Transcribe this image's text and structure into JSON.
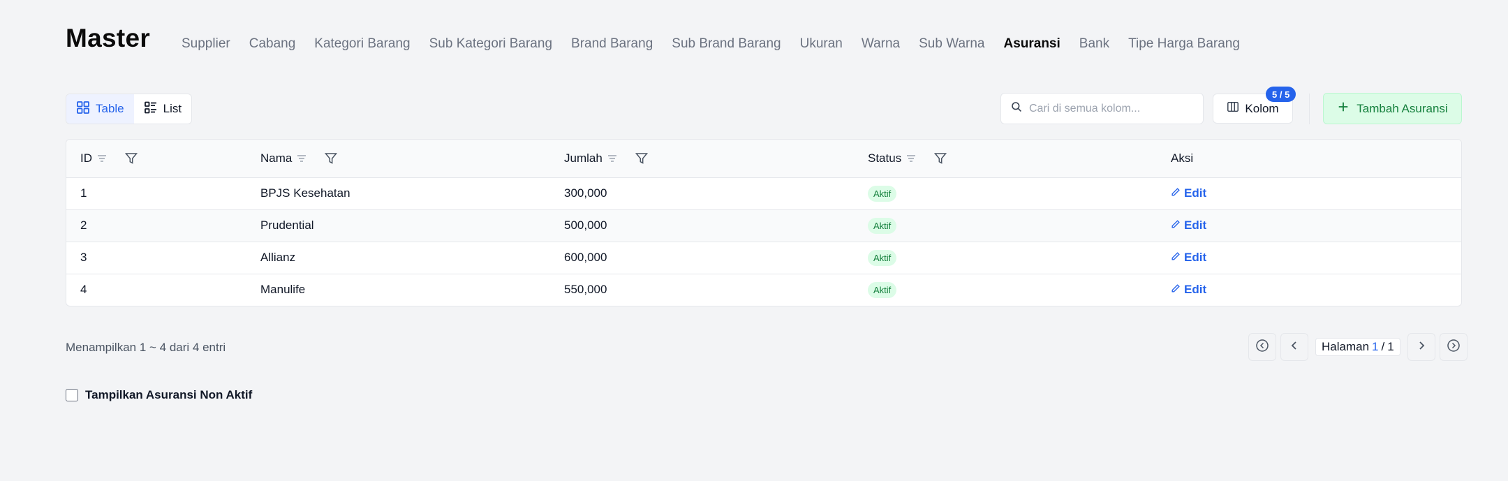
{
  "page": {
    "title": "Master"
  },
  "tabs": [
    {
      "label": "Supplier",
      "active": false
    },
    {
      "label": "Cabang",
      "active": false
    },
    {
      "label": "Kategori Barang",
      "active": false
    },
    {
      "label": "Sub Kategori Barang",
      "active": false
    },
    {
      "label": "Brand Barang",
      "active": false
    },
    {
      "label": "Sub Brand Barang",
      "active": false
    },
    {
      "label": "Ukuran",
      "active": false
    },
    {
      "label": "Warna",
      "active": false
    },
    {
      "label": "Sub Warna",
      "active": false
    },
    {
      "label": "Asuransi",
      "active": true
    },
    {
      "label": "Bank",
      "active": false
    },
    {
      "label": "Tipe Harga Barang",
      "active": false
    }
  ],
  "view_toggle": {
    "table_label": "Table",
    "list_label": "List",
    "selected": "Table"
  },
  "search": {
    "placeholder": "Cari di semua kolom...",
    "value": ""
  },
  "kolom": {
    "label": "Kolom",
    "badge": "5 / 5"
  },
  "add_button": {
    "label": "Tambah Asuransi"
  },
  "table": {
    "columns": [
      {
        "label": "ID",
        "sortable": true,
        "filterable": true
      },
      {
        "label": "Nama",
        "sortable": true,
        "filterable": true
      },
      {
        "label": "Jumlah",
        "sortable": true,
        "filterable": true
      },
      {
        "label": "Status",
        "sortable": true,
        "filterable": true
      },
      {
        "label": "Aksi",
        "sortable": false,
        "filterable": false
      }
    ],
    "rows": [
      {
        "id": "1",
        "nama": "BPJS Kesehatan",
        "jumlah": "300,000",
        "status": "Aktif",
        "aksi": "Edit"
      },
      {
        "id": "2",
        "nama": "Prudential",
        "jumlah": "500,000",
        "status": "Aktif",
        "aksi": "Edit"
      },
      {
        "id": "3",
        "nama": "Allianz",
        "jumlah": "600,000",
        "status": "Aktif",
        "aksi": "Edit"
      },
      {
        "id": "4",
        "nama": "Manulife",
        "jumlah": "550,000",
        "status": "Aktif",
        "aksi": "Edit"
      }
    ]
  },
  "footer": {
    "info": "Menampilkan 1 ~ 4 dari 4 entri"
  },
  "pagination": {
    "label": "Halaman",
    "current": "1",
    "separator": "/",
    "total": "1"
  },
  "checkbox": {
    "label": "Tampilkan Asuransi Non Aktif",
    "checked": false
  },
  "colors": {
    "accent": "#2563eb",
    "success": "#15803d",
    "success_bg": "#dcfce7",
    "background": "#f3f4f6"
  }
}
